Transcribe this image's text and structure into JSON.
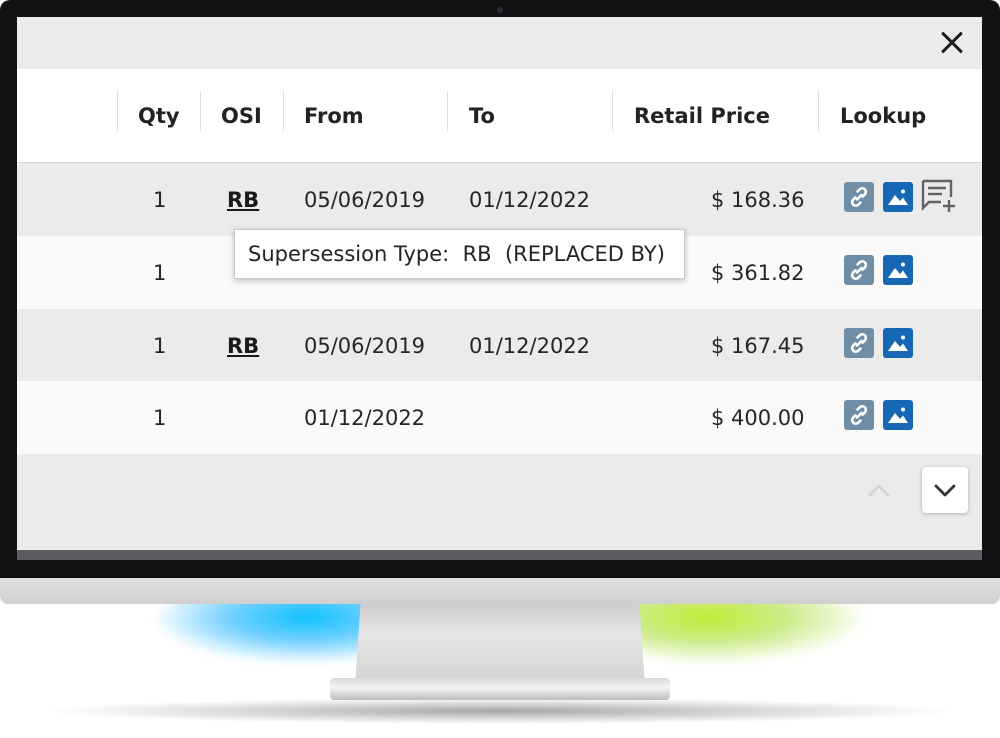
{
  "table": {
    "headers": {
      "qty": "Qty",
      "osi": "OSI",
      "from": "From",
      "to": "To",
      "retail_price": "Retail Price",
      "lookup": "Lookup"
    },
    "rows": [
      {
        "qty": "1",
        "osi": "RB",
        "from": "05/06/2019",
        "to": "01/12/2022",
        "price": "$ 168.36",
        "lookup_icons": [
          "link-icon",
          "image-icon",
          "add-note-icon"
        ]
      },
      {
        "qty": "1",
        "osi": "",
        "from": "",
        "to": "",
        "price": "$ 361.82",
        "lookup_icons": [
          "link-icon",
          "image-icon"
        ]
      },
      {
        "qty": "1",
        "osi": "RB",
        "from": "05/06/2019",
        "to": "01/12/2022",
        "price": "$ 167.45",
        "lookup_icons": [
          "link-icon",
          "image-icon"
        ]
      },
      {
        "qty": "1",
        "osi": "",
        "from": "01/12/2022",
        "to": "",
        "price": "$ 400.00",
        "lookup_icons": [
          "link-icon",
          "image-icon"
        ]
      }
    ]
  },
  "tooltip": {
    "text": "Supersession Type:  RB  (REPLACED BY)"
  },
  "icons": {
    "close": "close-icon",
    "scroll_up": "chevron-up-icon",
    "scroll_down": "chevron-down-icon"
  },
  "colors": {
    "link_icon_bg": "#6f8ea6",
    "image_icon_bg": "#1667b4",
    "row_shaded": "#ebebec",
    "row_light": "#fafafa"
  }
}
